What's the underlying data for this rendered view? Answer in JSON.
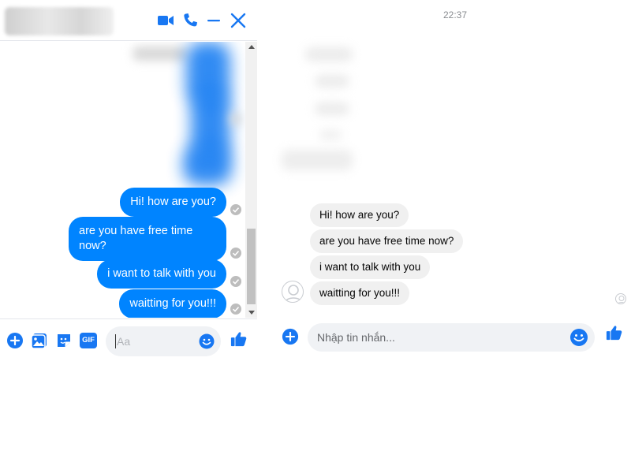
{
  "left_window": {
    "header": {
      "contact_name_blurred": "",
      "icons": [
        "video-call-icon",
        "phone-call-icon",
        "minimize-icon",
        "close-icon"
      ]
    },
    "messages": [
      {
        "text": "Hi! how are you?"
      },
      {
        "text": "are you have free time now?"
      },
      {
        "text": "i want to talk with you"
      },
      {
        "text": "waitting for you!!!"
      }
    ],
    "composer": {
      "icons": [
        "add-icon",
        "photo-icon",
        "sticker-icon",
        "gif-icon",
        "emoji-icon",
        "like-icon"
      ],
      "gif_label": "GIF",
      "placeholder": "Aa"
    }
  },
  "right_window": {
    "timestamp": "22:37",
    "messages": [
      {
        "text": "Hi! how are you?"
      },
      {
        "text": "are you have free time now?"
      },
      {
        "text": "i want to talk with you"
      },
      {
        "text": "waitting for you!!!"
      }
    ],
    "composer": {
      "placeholder": "Nhập tin nhắn..."
    }
  },
  "colors": {
    "accent": "#0084ff",
    "icon_blue": "#1877f2",
    "incoming_bubble": "#f0f0f0",
    "input_bg": "#f0f2f5"
  }
}
